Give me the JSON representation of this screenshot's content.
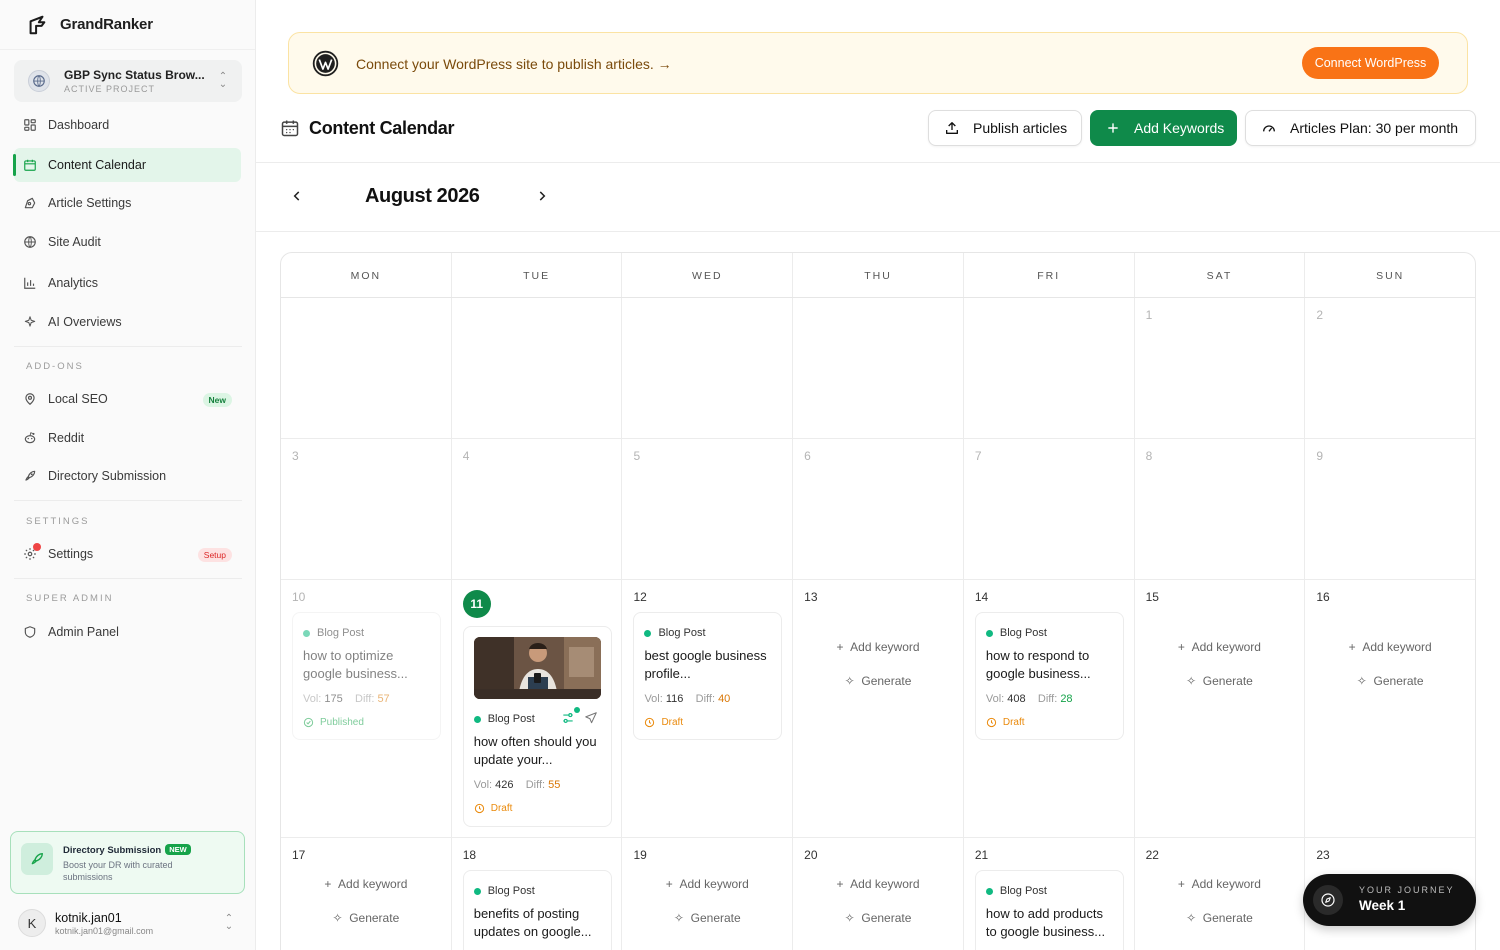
{
  "brand": {
    "name": "GrandRanker"
  },
  "project": {
    "name": "GBP Sync Status Brow...",
    "status": "ACTIVE PROJECT"
  },
  "nav": {
    "main": [
      {
        "label": "Dashboard",
        "icon": "grid-icon"
      },
      {
        "label": "Content Calendar",
        "icon": "calendar-icon",
        "active": true
      },
      {
        "label": "Article Settings",
        "icon": "pen-tool-icon"
      },
      {
        "label": "Site Audit",
        "icon": "globe-icon"
      },
      {
        "label": "Analytics",
        "icon": "bar-chart-icon"
      },
      {
        "label": "AI Overviews",
        "icon": "sparkle-icon"
      }
    ],
    "addons_label": "ADD-ONS",
    "addons": [
      {
        "label": "Local SEO",
        "badge": "New"
      },
      {
        "label": "Reddit"
      },
      {
        "label": "Directory Submission"
      }
    ],
    "settings_label": "SETTINGS",
    "settings": {
      "label": "Settings",
      "badge": "Setup"
    },
    "super_admin_label": "SUPER ADMIN",
    "admin": {
      "label": "Admin Panel"
    }
  },
  "promo": {
    "title": "Directory Submission",
    "badge": "NEW",
    "description": "Boost your DR with curated submissions"
  },
  "user": {
    "initial": "K",
    "name": "kotnik.jan01",
    "email": "kotnik.jan01@gmail.com"
  },
  "banner": {
    "text": "Connect your WordPress site to publish articles. →",
    "button": "Connect WordPress"
  },
  "header": {
    "title": "Content Calendar",
    "publish_label": "Publish articles",
    "add_keywords_label": "Add Keywords",
    "plan_label": "Articles Plan: 30 per month"
  },
  "calendar": {
    "month": "August 2026",
    "weekdays": [
      "MON",
      "TUE",
      "WED",
      "THU",
      "FRI",
      "SAT",
      "SUN"
    ],
    "add_keyword": "Add keyword",
    "generate": "Generate",
    "vol_label": "Vol:",
    "diff_label": "Diff:",
    "post_type": "Blog Post",
    "posts": {
      "10": {
        "title": "how to optimize google business...",
        "vol": "175",
        "diff": "57",
        "status": "Published"
      },
      "11": {
        "title": "how often should you update your...",
        "vol": "426",
        "diff": "55",
        "status": "Draft"
      },
      "12": {
        "title": "best google business profile...",
        "vol": "116",
        "diff": "40",
        "status": "Draft"
      },
      "14": {
        "title": "how to respond to google business...",
        "vol": "408",
        "diff": "28",
        "status": "Draft"
      },
      "18": {
        "title": "benefits of posting updates on google..."
      },
      "21": {
        "title": "how to add products to google business..."
      }
    }
  },
  "journey": {
    "label": "YOUR JOURNEY",
    "value": "Week 1"
  },
  "colors": {
    "accent": "#0f8a4a",
    "warning": "#f97316",
    "banner_bg": "#fffaec"
  }
}
